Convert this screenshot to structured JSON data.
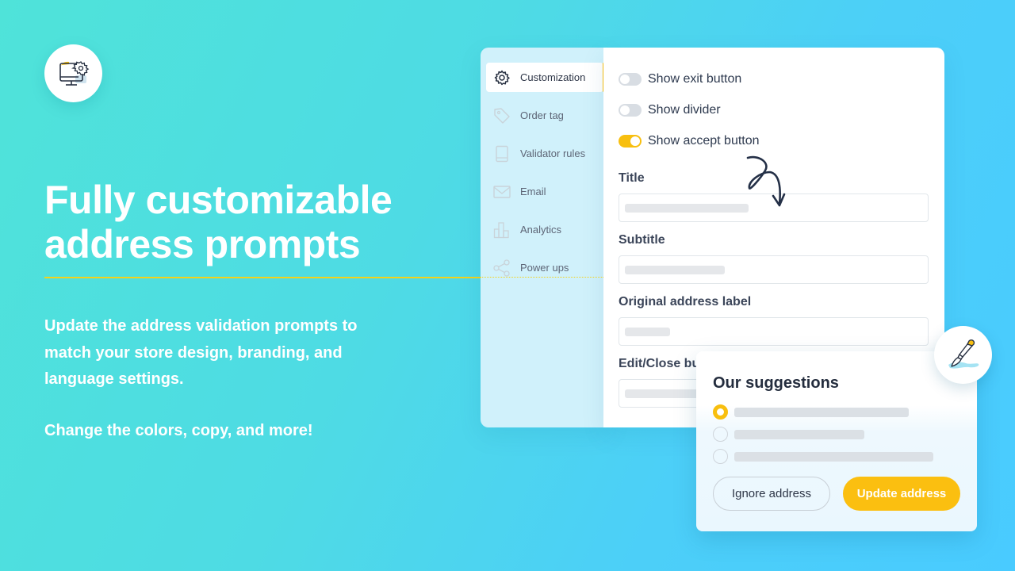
{
  "hero": {
    "icon": "monitor-gear-icon",
    "headline_line1": "Fully customizable",
    "headline_line2": "address prompts",
    "description_line1": "Update the address validation prompts to",
    "description_line2": "match your store design, branding, and",
    "description_line3": "language settings.",
    "cta": "Change the colors, copy, and more!"
  },
  "sidebar": {
    "items": [
      {
        "label": "Customization",
        "icon": "gear-icon",
        "active": true
      },
      {
        "label": "Order tag",
        "icon": "tag-icon",
        "active": false
      },
      {
        "label": "Validator rules",
        "icon": "book-icon",
        "active": false
      },
      {
        "label": "Email",
        "icon": "envelope-icon",
        "active": false
      },
      {
        "label": "Analytics",
        "icon": "bar-chart-icon",
        "active": false
      },
      {
        "label": "Power ups",
        "icon": "share-icon",
        "active": false
      }
    ]
  },
  "settings": {
    "toggles": [
      {
        "label": "Show exit button",
        "on": false
      },
      {
        "label": "Show divider",
        "on": false
      },
      {
        "label": "Show accept button",
        "on": true
      }
    ],
    "fields": [
      {
        "label": "Title"
      },
      {
        "label": "Subtitle"
      },
      {
        "label": "Original address label"
      },
      {
        "label": "Edit/Close button label"
      }
    ]
  },
  "suggestions": {
    "title": "Our suggestions",
    "options": [
      {
        "selected": true
      },
      {
        "selected": false
      },
      {
        "selected": false
      }
    ],
    "ignore_label": "Ignore address",
    "update_label": "Update address"
  },
  "colors": {
    "accent": "#fbbf10",
    "text_dark": "#242d3e",
    "sidebar_bg": "#d0f1fb",
    "background_start": "#4fe3d9",
    "background_end": "#49cbff"
  },
  "badge": {
    "icon": "paintbrush-icon"
  }
}
